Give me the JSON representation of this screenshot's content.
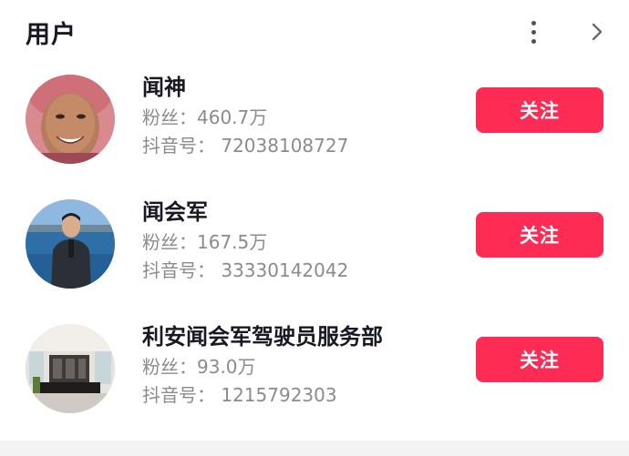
{
  "section": {
    "title": "用户",
    "more_icon": "more-vertical-icon",
    "chevron_icon": "chevron-right-icon"
  },
  "users": [
    {
      "name": "闻神",
      "fans_label": "粉丝：",
      "fans_value": "460.7万",
      "id_label": "抖音号：",
      "id_value": "72038108727",
      "follow_label": "关注",
      "avatar": "avatar-pink-hood-man"
    },
    {
      "name": "闻会军",
      "fans_label": "粉丝：",
      "fans_value": "167.5万",
      "id_label": "抖音号：",
      "id_value": "33330142042",
      "follow_label": "关注",
      "avatar": "avatar-man-by-lake"
    },
    {
      "name": "利安闻会军驾驶员服务部",
      "fans_label": "粉丝：",
      "fans_value": "93.0万",
      "id_label": "抖音号：",
      "id_value": "1215792303",
      "follow_label": "关注",
      "avatar": "avatar-office-interior"
    }
  ],
  "colors": {
    "follow_button": "#fe2c55",
    "name_text": "#161823",
    "meta_text": "#8a8b91",
    "bottom_bar": "#f3f3f4"
  }
}
